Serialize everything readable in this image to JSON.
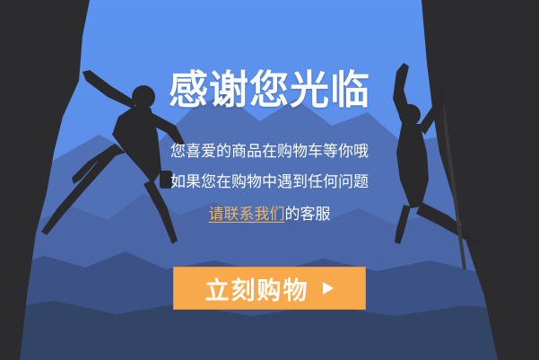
{
  "dialog": {
    "title": "感谢您光临",
    "line1": "您喜爱的商品在购物车等你哦",
    "line2": "如果您在购物中遇到任何问题",
    "line3_link": "请联系我们",
    "line3_suffix": "的客服"
  },
  "cta": {
    "label": "立刻购物",
    "icon": "play-triangle-icon"
  },
  "colors": {
    "sky": "#5b94f1",
    "mountains_far": "#4a6aa8",
    "mountains_near": "#334566",
    "rock": "#2c2c2e",
    "link": "#f2b454",
    "button": "#f8a94b"
  }
}
